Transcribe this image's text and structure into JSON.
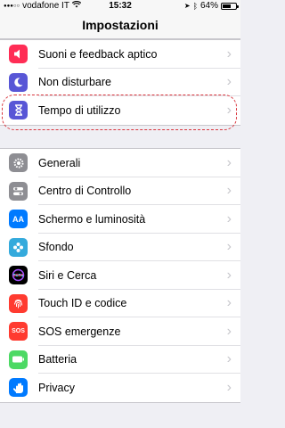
{
  "status_bar": {
    "carrier": "vodafone IT",
    "time": "15:32",
    "battery_percent": "64%",
    "battery_level": 0.64
  },
  "nav": {
    "title": "Impostazioni"
  },
  "group1": [
    {
      "label": "Suoni e feedback aptico",
      "icon": "speaker-icon",
      "color": "#ff2d55"
    },
    {
      "label": "Non disturbare",
      "icon": "moon-icon",
      "color": "#5856d6"
    },
    {
      "label": "Tempo di utilizzo",
      "icon": "hourglass-icon",
      "color": "#5856d6"
    }
  ],
  "group2": [
    {
      "label": "Generali",
      "icon": "gear-icon",
      "color": "#8e8e93"
    },
    {
      "label": "Centro di Controllo",
      "icon": "toggles-icon",
      "color": "#8e8e93"
    },
    {
      "label": "Schermo e luminosità",
      "icon": "aa-icon",
      "icon_text": "AA",
      "color": "#007aff"
    },
    {
      "label": "Sfondo",
      "icon": "flower-icon",
      "color": "#34aadc"
    },
    {
      "label": "Siri e Cerca",
      "icon": "siri-icon",
      "color": "#000000"
    },
    {
      "label": "Touch ID e codice",
      "icon": "fingerprint-icon",
      "color": "#ff3b30"
    },
    {
      "label": "SOS emergenze",
      "icon": "sos-icon",
      "icon_text": "SOS",
      "color": "#ff3b30"
    },
    {
      "label": "Batteria",
      "icon": "battery-icon",
      "color": "#4cd964"
    },
    {
      "label": "Privacy",
      "icon": "hand-icon",
      "color": "#007aff"
    }
  ]
}
